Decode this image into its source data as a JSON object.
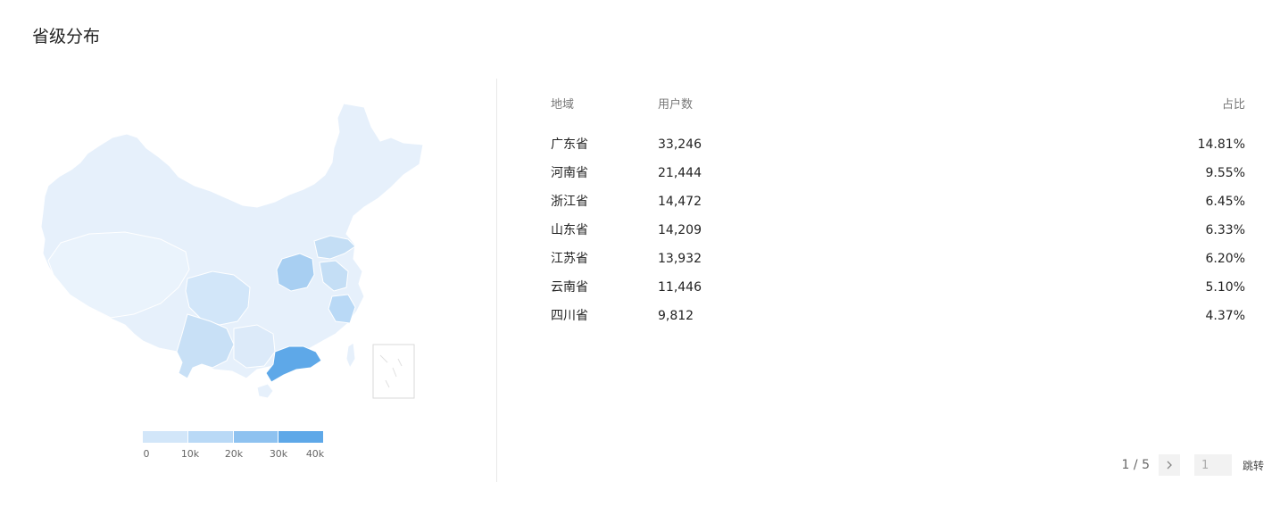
{
  "page": {
    "title": "省级分布"
  },
  "map": {
    "colors": {
      "low": "#e6f0fb",
      "light": "#d7e8f8",
      "mid": "#c4def5",
      "strong": "#a8cff2",
      "max": "#5ea8e8",
      "border": "#ffffff"
    }
  },
  "legend": {
    "colors": [
      "#e6f0fb",
      "#d2e6f9",
      "#b9d9f6",
      "#8ec2f0",
      "#5ea8e8"
    ],
    "ticks": [
      "0",
      "10k",
      "20k",
      "30k",
      "40k"
    ]
  },
  "table": {
    "headers": {
      "region": "地域",
      "users": "用户数",
      "ratio": "占比"
    },
    "rows": [
      {
        "region": "广东省",
        "users": "33,246",
        "ratio": "14.81%"
      },
      {
        "region": "河南省",
        "users": "21,444",
        "ratio": "9.55%"
      },
      {
        "region": "浙江省",
        "users": "14,472",
        "ratio": "6.45%"
      },
      {
        "region": "山东省",
        "users": "14,209",
        "ratio": "6.33%"
      },
      {
        "region": "江苏省",
        "users": "13,932",
        "ratio": "6.20%"
      },
      {
        "region": "云南省",
        "users": "11,446",
        "ratio": "5.10%"
      },
      {
        "region": "四川省",
        "users": "9,812",
        "ratio": "4.37%"
      }
    ]
  },
  "pagination": {
    "page_info": "1 / 5",
    "input_value": "1",
    "jump_label": "跳转",
    "next_icon": "chevron-right-icon"
  }
}
